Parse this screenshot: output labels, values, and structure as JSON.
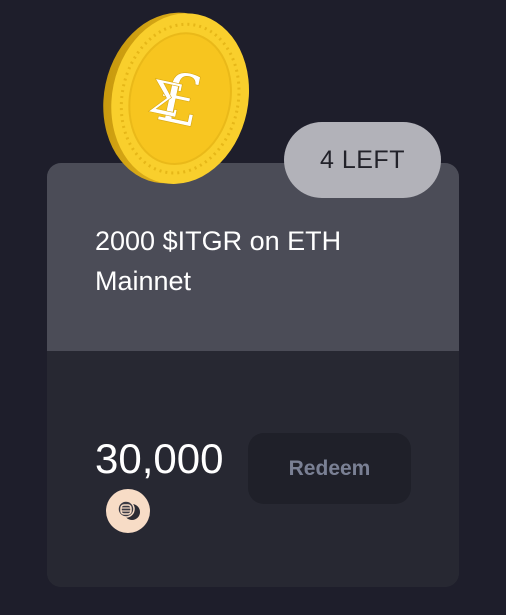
{
  "reward": {
    "title": "2000 $ITGR on ETH Mainnet",
    "remaining_label": "4 LEFT",
    "price": "30,000",
    "redeem_label": "Redeem",
    "coin_icon": "coin-stack-icon",
    "token_icon": "itgr-coin-icon"
  },
  "colors": {
    "background": "#1e1e2b",
    "card_top": "#4b4c57",
    "card_bottom": "#272832",
    "badge": "#b2b2b9",
    "coin_gold": "#f7c51f",
    "button_text": "#7a8094"
  }
}
